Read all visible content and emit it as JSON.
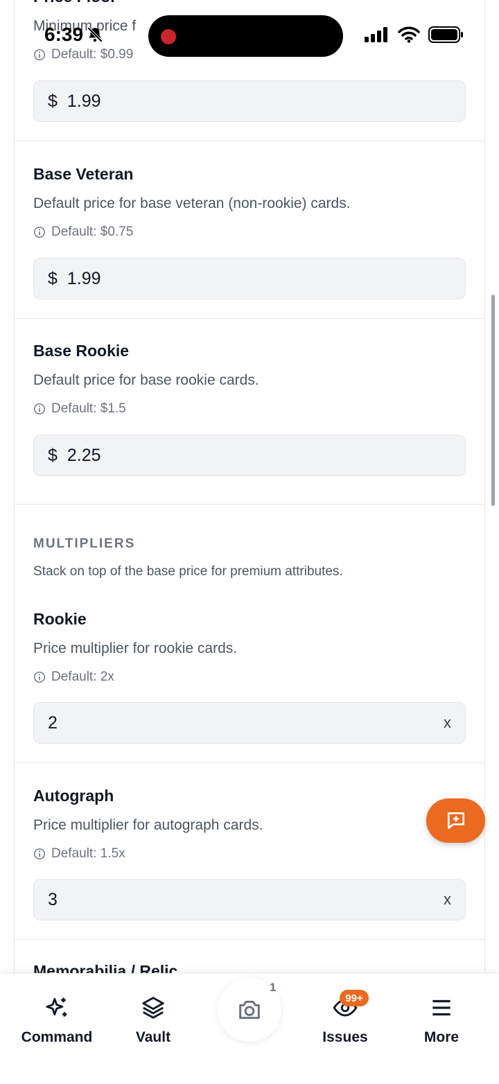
{
  "status_bar": {
    "time": "6:39"
  },
  "sections": [
    {
      "title": "Price Floor",
      "description": "Minimum price f",
      "default_hint": "Default: $0.99",
      "prefix": "$",
      "value": "1.99"
    },
    {
      "title": "Base Veteran",
      "description": "Default price for base veteran (non-rookie) cards.",
      "default_hint": "Default: $0.75",
      "prefix": "$",
      "value": "1.99"
    },
    {
      "title": "Base Rookie",
      "description": "Default price for base rookie cards.",
      "default_hint": "Default: $1.5",
      "prefix": "$",
      "value": "2.25"
    }
  ],
  "multipliers": {
    "heading": "MULTIPLIERS",
    "description": "Stack on top of the base price for premium attributes.",
    "items": [
      {
        "title": "Rookie",
        "description": "Price multiplier for rookie cards.",
        "default_hint": "Default: 2x",
        "value": "2",
        "suffix": "x"
      },
      {
        "title": "Autograph",
        "description": "Price multiplier for autograph cards.",
        "default_hint": "Default: 1.5x",
        "value": "3",
        "suffix": "x"
      }
    ],
    "next_title_partial": "Memorabilia / Relic"
  },
  "tab_bar": {
    "tabs": [
      {
        "label": "Command",
        "icon": "sparkles-icon"
      },
      {
        "label": "Vault",
        "icon": "layers-icon"
      },
      {
        "label": "",
        "icon": "camera-icon"
      },
      {
        "label": "Issues",
        "icon": "eye-icon"
      },
      {
        "label": "More",
        "icon": "menu-icon"
      }
    ],
    "camera_count": "1",
    "issues_badge": "99+"
  },
  "colors": {
    "accent": "#ea6a1f",
    "field_bg": "#f2f3f5",
    "record_dot": "#c9252b"
  }
}
